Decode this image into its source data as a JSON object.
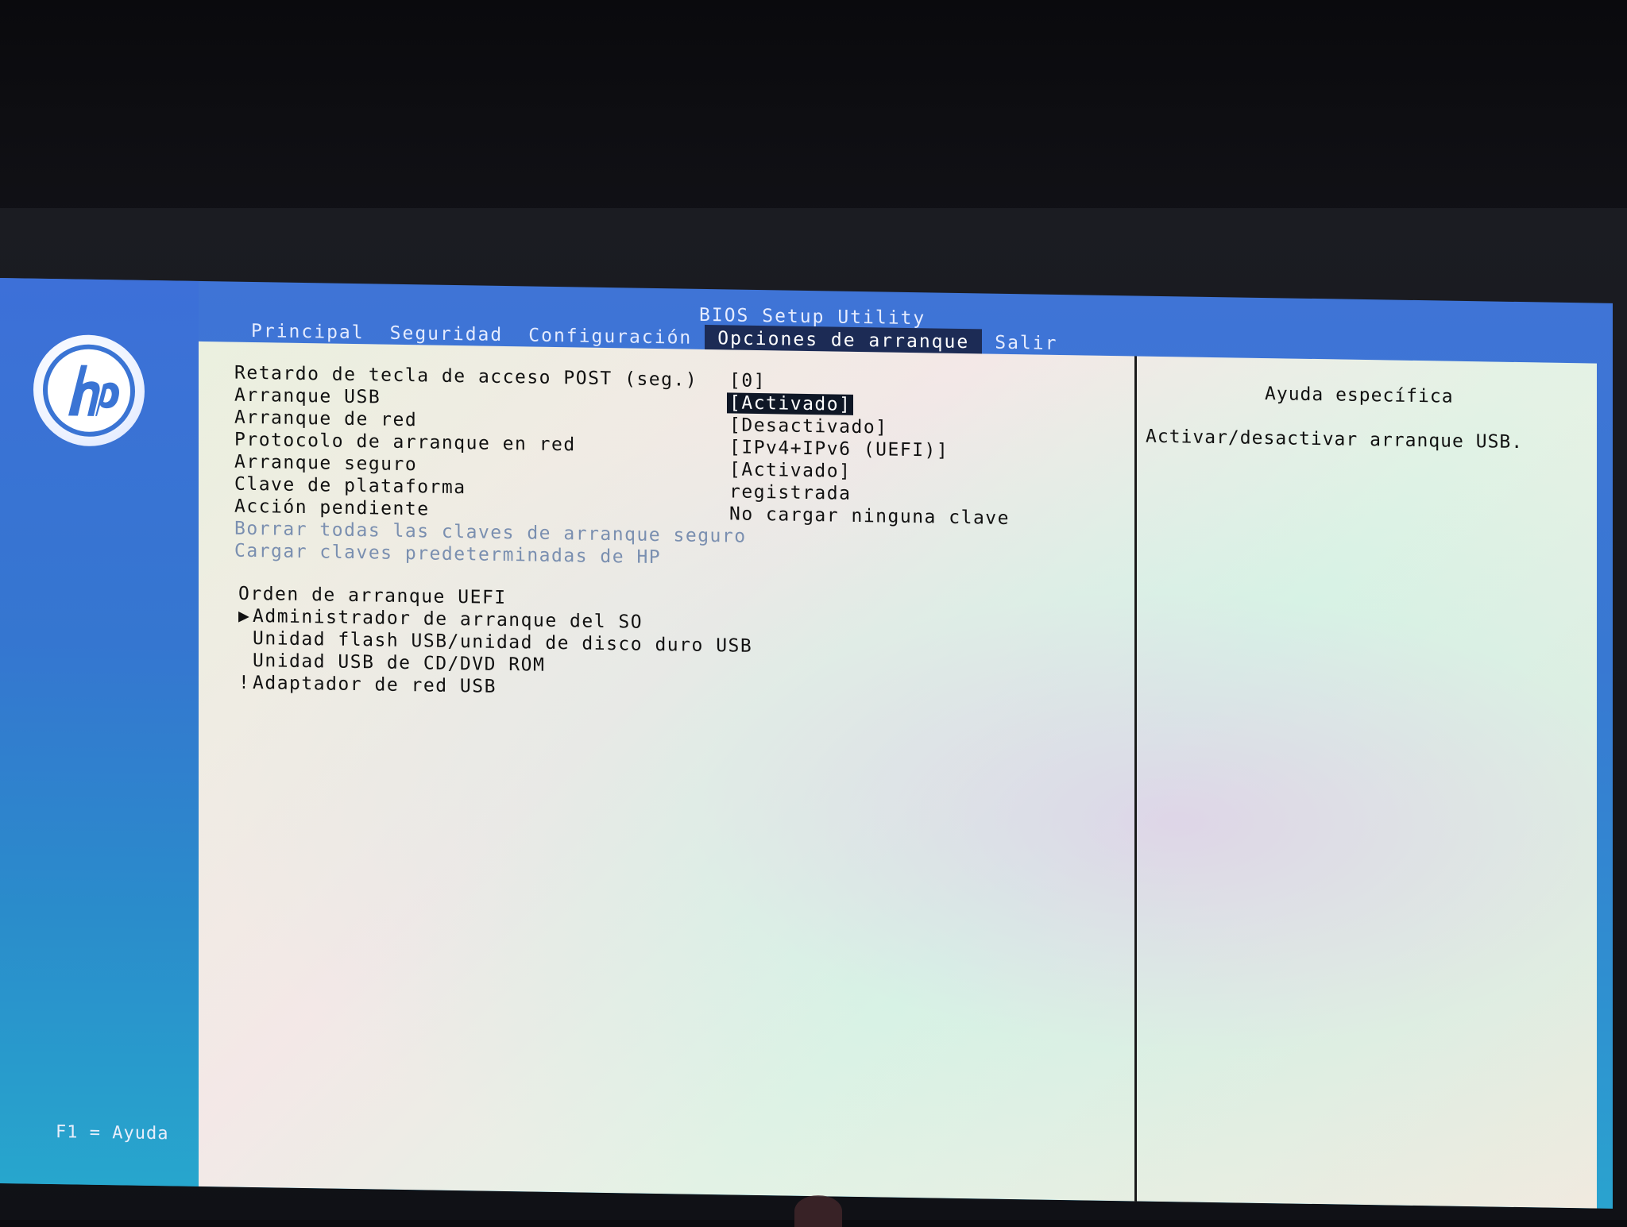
{
  "header": {
    "title": "BIOS Setup Utility",
    "tabs": [
      {
        "label": "Principal"
      },
      {
        "label": "Seguridad"
      },
      {
        "label": "Configuración"
      },
      {
        "label": "Opciones de arranque"
      },
      {
        "label": "Salir"
      }
    ],
    "active_tab": "Opciones de arranque"
  },
  "sidebar": {
    "logo": "hp",
    "footer_hint": "F1 = Ayuda"
  },
  "settings": [
    {
      "label": "Retardo de tecla de acceso POST (seg.)",
      "value": "[0]"
    },
    {
      "label": "Arranque USB",
      "value": "[Activado]"
    },
    {
      "label": "Arranque de red",
      "value": "[Desactivado]"
    },
    {
      "label": "Protocolo de arranque en red",
      "value": "[IPv4+IPv6 (UEFI)]"
    },
    {
      "label": "Arranque seguro",
      "value": "[Activado]"
    },
    {
      "label": "Clave de plataforma",
      "value": "registrada"
    },
    {
      "label": "Acción pendiente",
      "value": "No cargar ninguna clave"
    },
    {
      "label": "Borrar todas las claves de arranque seguro",
      "value": ""
    },
    {
      "label": "Cargar claves predeterminadas de HP",
      "value": ""
    }
  ],
  "boot_order": {
    "title": "Orden de arranque UEFI",
    "items": [
      {
        "marker": "▶",
        "label": "Administrador de arranque del SO"
      },
      {
        "marker": "",
        "label": "Unidad flash USB/unidad de disco duro USB"
      },
      {
        "marker": "",
        "label": "Unidad USB de CD/DVD ROM"
      },
      {
        "marker": "!",
        "label": "Adaptador de red USB"
      }
    ]
  },
  "help": {
    "title": "Ayuda específica",
    "text": "Activar/desactivar arranque USB."
  },
  "colors": {
    "screen_blue": "#3a74d4",
    "content_bg": "#eaf0e4",
    "selected_bg": "#0f1726",
    "disabled_text": "#7a8fb0"
  }
}
